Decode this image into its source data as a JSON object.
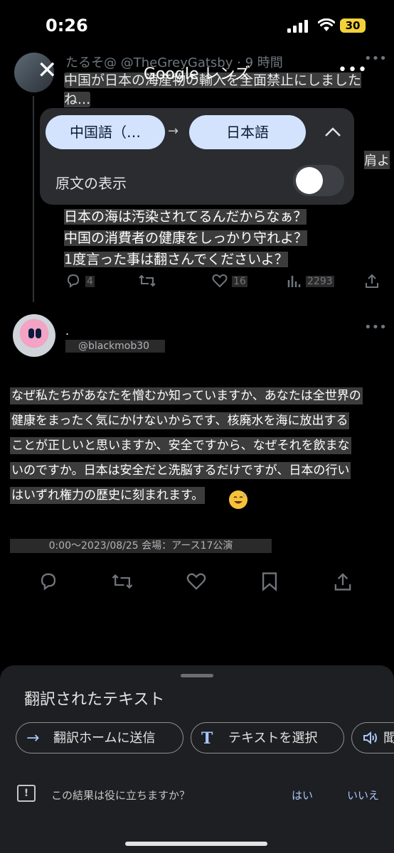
{
  "status": {
    "time": "0:26",
    "battery": "30"
  },
  "lens": {
    "title": "Google レンズ",
    "close": "✕",
    "more": "•••"
  },
  "tweet1": {
    "author": "たるそ@",
    "handle": "@TheGreyGatsby",
    "age": "· 9 時間",
    "text": "中国が日本の海産物の輸入を全面禁止にしましたね...",
    "edge_char": "肩よ",
    "lines": [
      "日本の海は汚染されてるんだからなぁ？",
      "中国の消費者の健康をしっかり守れよ？",
      "1度言った事は翻さんでくださいよ？"
    ],
    "replies": "4",
    "likes": "16",
    "views": "2293"
  },
  "translate_panel": {
    "source_lang": "中国語（…",
    "target_lang": "日本語",
    "show_original_label": "原文の表示",
    "show_original_on": false
  },
  "tweet2": {
    "display": ".",
    "handle": "@blackmob30",
    "lines": [
      "なぜ私たちがあなたを憎むか知っていますか、あなたは全世界の",
      "健康をまったく気にかけないからです、核廃水を海に放出する",
      "ことが正しいと思いますか、安全ですから、なぜそれを飲まな",
      "いのですか。日本は安全だと洗脳するだけですが、日本の行い",
      "はいずれ権力の歴史に刻まれます。"
    ],
    "meta": "0:00～2023/08/25 会場：アース17公演"
  },
  "sheet": {
    "title": "翻訳されたテキスト",
    "btn_send": "翻訳ホームに送信",
    "btn_select": "テキストを選択",
    "btn_listen": "聞",
    "feedback_q": "この結果は役に立ちますか？",
    "yes": "はい",
    "no": "いいえ"
  },
  "colors": {
    "chip_bg": "#d3e3fd",
    "accent_blue": "#a8c7fa",
    "battery": "#f2d13a"
  }
}
